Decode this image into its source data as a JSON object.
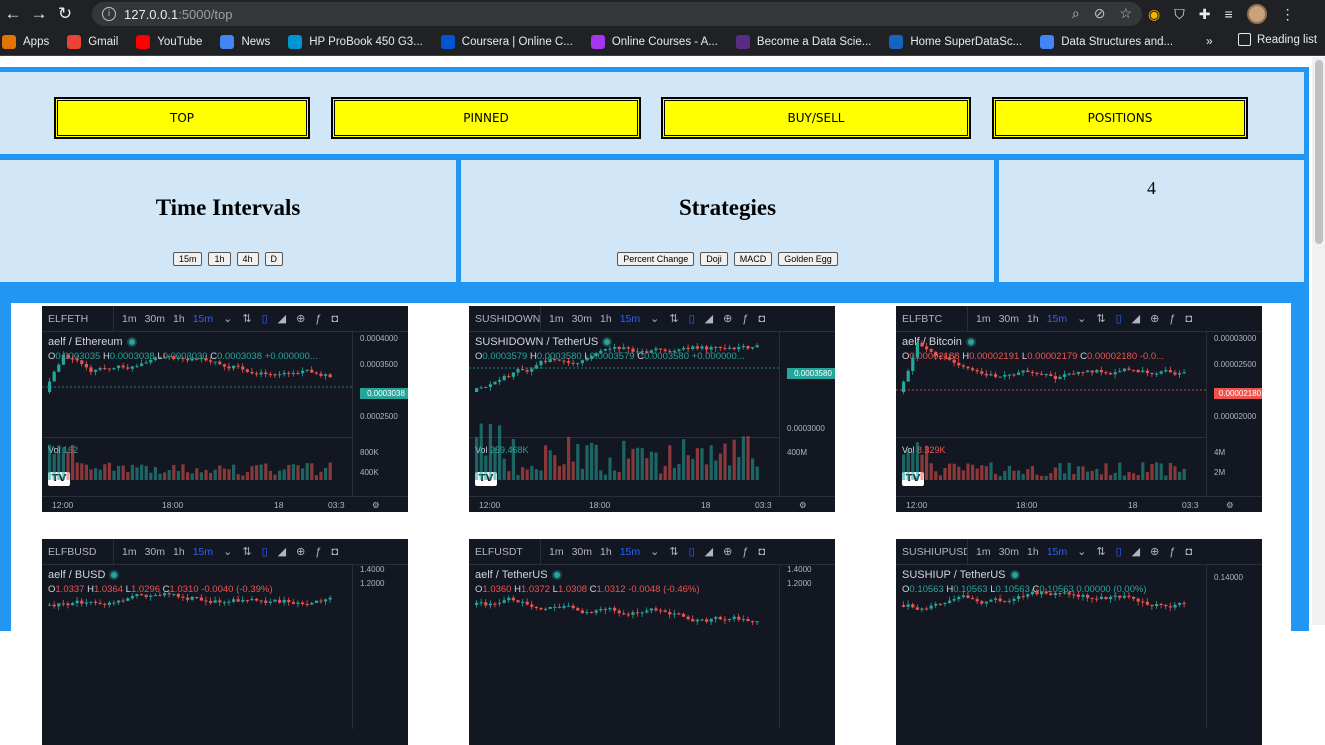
{
  "browser": {
    "url_host": "127.0.0.1",
    "url_path": ":5000/top",
    "bookmarks": [
      {
        "label": "Apps",
        "color": "#e37400",
        "icon": "apps-grid-icon"
      },
      {
        "label": "Gmail",
        "color": "#ea4335",
        "icon": "gmail-icon"
      },
      {
        "label": "YouTube",
        "color": "#ff0000",
        "icon": "youtube-icon"
      },
      {
        "label": "News",
        "color": "#4285f4",
        "icon": "news-icon"
      },
      {
        "label": "HP ProBook 450 G3...",
        "color": "#0096d6",
        "icon": "hp-icon"
      },
      {
        "label": "Coursera | Online C...",
        "color": "#0056d2",
        "icon": "coursera-icon"
      },
      {
        "label": "Online Courses - A...",
        "color": "#a435f0",
        "icon": "udemy-icon"
      },
      {
        "label": "Become a Data Scie...",
        "color": "#5b2c83",
        "icon": "datascience-icon"
      },
      {
        "label": "Home SuperDataSc...",
        "color": "#1565c0",
        "icon": "superdatascience-icon"
      },
      {
        "label": "Data Structures and...",
        "color": "#4285f4",
        "icon": "link-icon"
      }
    ],
    "more": "»",
    "reading_list": "Reading list"
  },
  "nav": {
    "buttons": [
      "TOP",
      "PINNED",
      "BUY/SELL",
      "POSITIONS"
    ]
  },
  "time_intervals": {
    "title": "Time Intervals",
    "options": [
      "15m",
      "1h",
      "4h",
      "D"
    ]
  },
  "strategies": {
    "title": "Strategies",
    "options": [
      "Percent Change",
      "Doji",
      "MACD",
      "Golden Egg"
    ]
  },
  "counter": "4",
  "toolbar": {
    "intervals": [
      "1m",
      "30m",
      "1h",
      "15m"
    ],
    "active_interval": "15m"
  },
  "colors": {
    "up": "#26a69a",
    "down": "#ef5350",
    "accent": "#2196f3",
    "button": "#ffff00"
  },
  "cards": [
    {
      "symbol": "ELFETH",
      "pair": "aelf / Ethereum",
      "o": "0.0003035",
      "h": "0.0003038",
      "l": "0.0003030",
      "c": "0.0003038",
      "chg": "+0.000000...",
      "trend": "up",
      "vol": "162",
      "vol_trend": "up",
      "price_labels": [
        "0.0004000",
        "0.0003500",
        "0.0003038",
        "0.0002500"
      ],
      "vol_labels": [
        "800K",
        "400K"
      ],
      "time_labels": [
        "12:00",
        "18:00",
        "18",
        "03:3"
      ]
    },
    {
      "symbol": "SUSHIDOWN",
      "pair": "SUSHIDOWN / TetherUS",
      "o": "0.0003579",
      "h": "0.0003580",
      "l": "0.0003579",
      "c": "0.0003580",
      "chg": "+0.000000...",
      "trend": "up",
      "vol": "259.468K",
      "vol_trend": "up",
      "price_labels": [
        "0.0003580",
        "0.0003000"
      ],
      "vol_labels": [
        "400M"
      ],
      "time_labels": [
        "12:00",
        "18:00",
        "18",
        "03:3"
      ]
    },
    {
      "symbol": "ELFBTC",
      "pair": "aelf / Bitcoin",
      "o": "0.00002188",
      "h": "0.00002191",
      "l": "0.00002179",
      "c": "0.00002180",
      "chg": "-0.0...",
      "trend": "down",
      "vol": "8.329K",
      "vol_trend": "down",
      "price_labels": [
        "0.00003000",
        "0.00002500",
        "0.00002180",
        "0.00002000"
      ],
      "vol_labels": [
        "4M",
        "2M"
      ],
      "time_labels": [
        "12:00",
        "18:00",
        "18",
        "03:3"
      ]
    },
    {
      "symbol": "ELFBUSD",
      "pair": "aelf / BUSD",
      "o": "1.0337",
      "h": "1.0364",
      "l": "1.0296",
      "c": "1.0310",
      "chg": "-0.0040 (-0.39%)",
      "trend": "down",
      "price_labels": [
        "1.4000",
        "1.2000"
      ]
    },
    {
      "symbol": "ELFUSDT",
      "pair": "aelf / TetherUS",
      "o": "1.0360",
      "h": "1.0372",
      "l": "1.0308",
      "c": "1.0312",
      "chg": "-0.0048 (-0.46%)",
      "trend": "down",
      "price_labels": [
        "1.4000",
        "1.2000"
      ]
    },
    {
      "symbol": "SUSHIUPUSD",
      "pair": "SUSHIUP / TetherUS",
      "o": "0.10563",
      "h": "0.10563",
      "l": "0.10563",
      "c": "0.10563",
      "chg": "0.00000 (0.00%)",
      "trend": "up",
      "price_labels": [
        "0.14000"
      ]
    }
  ]
}
